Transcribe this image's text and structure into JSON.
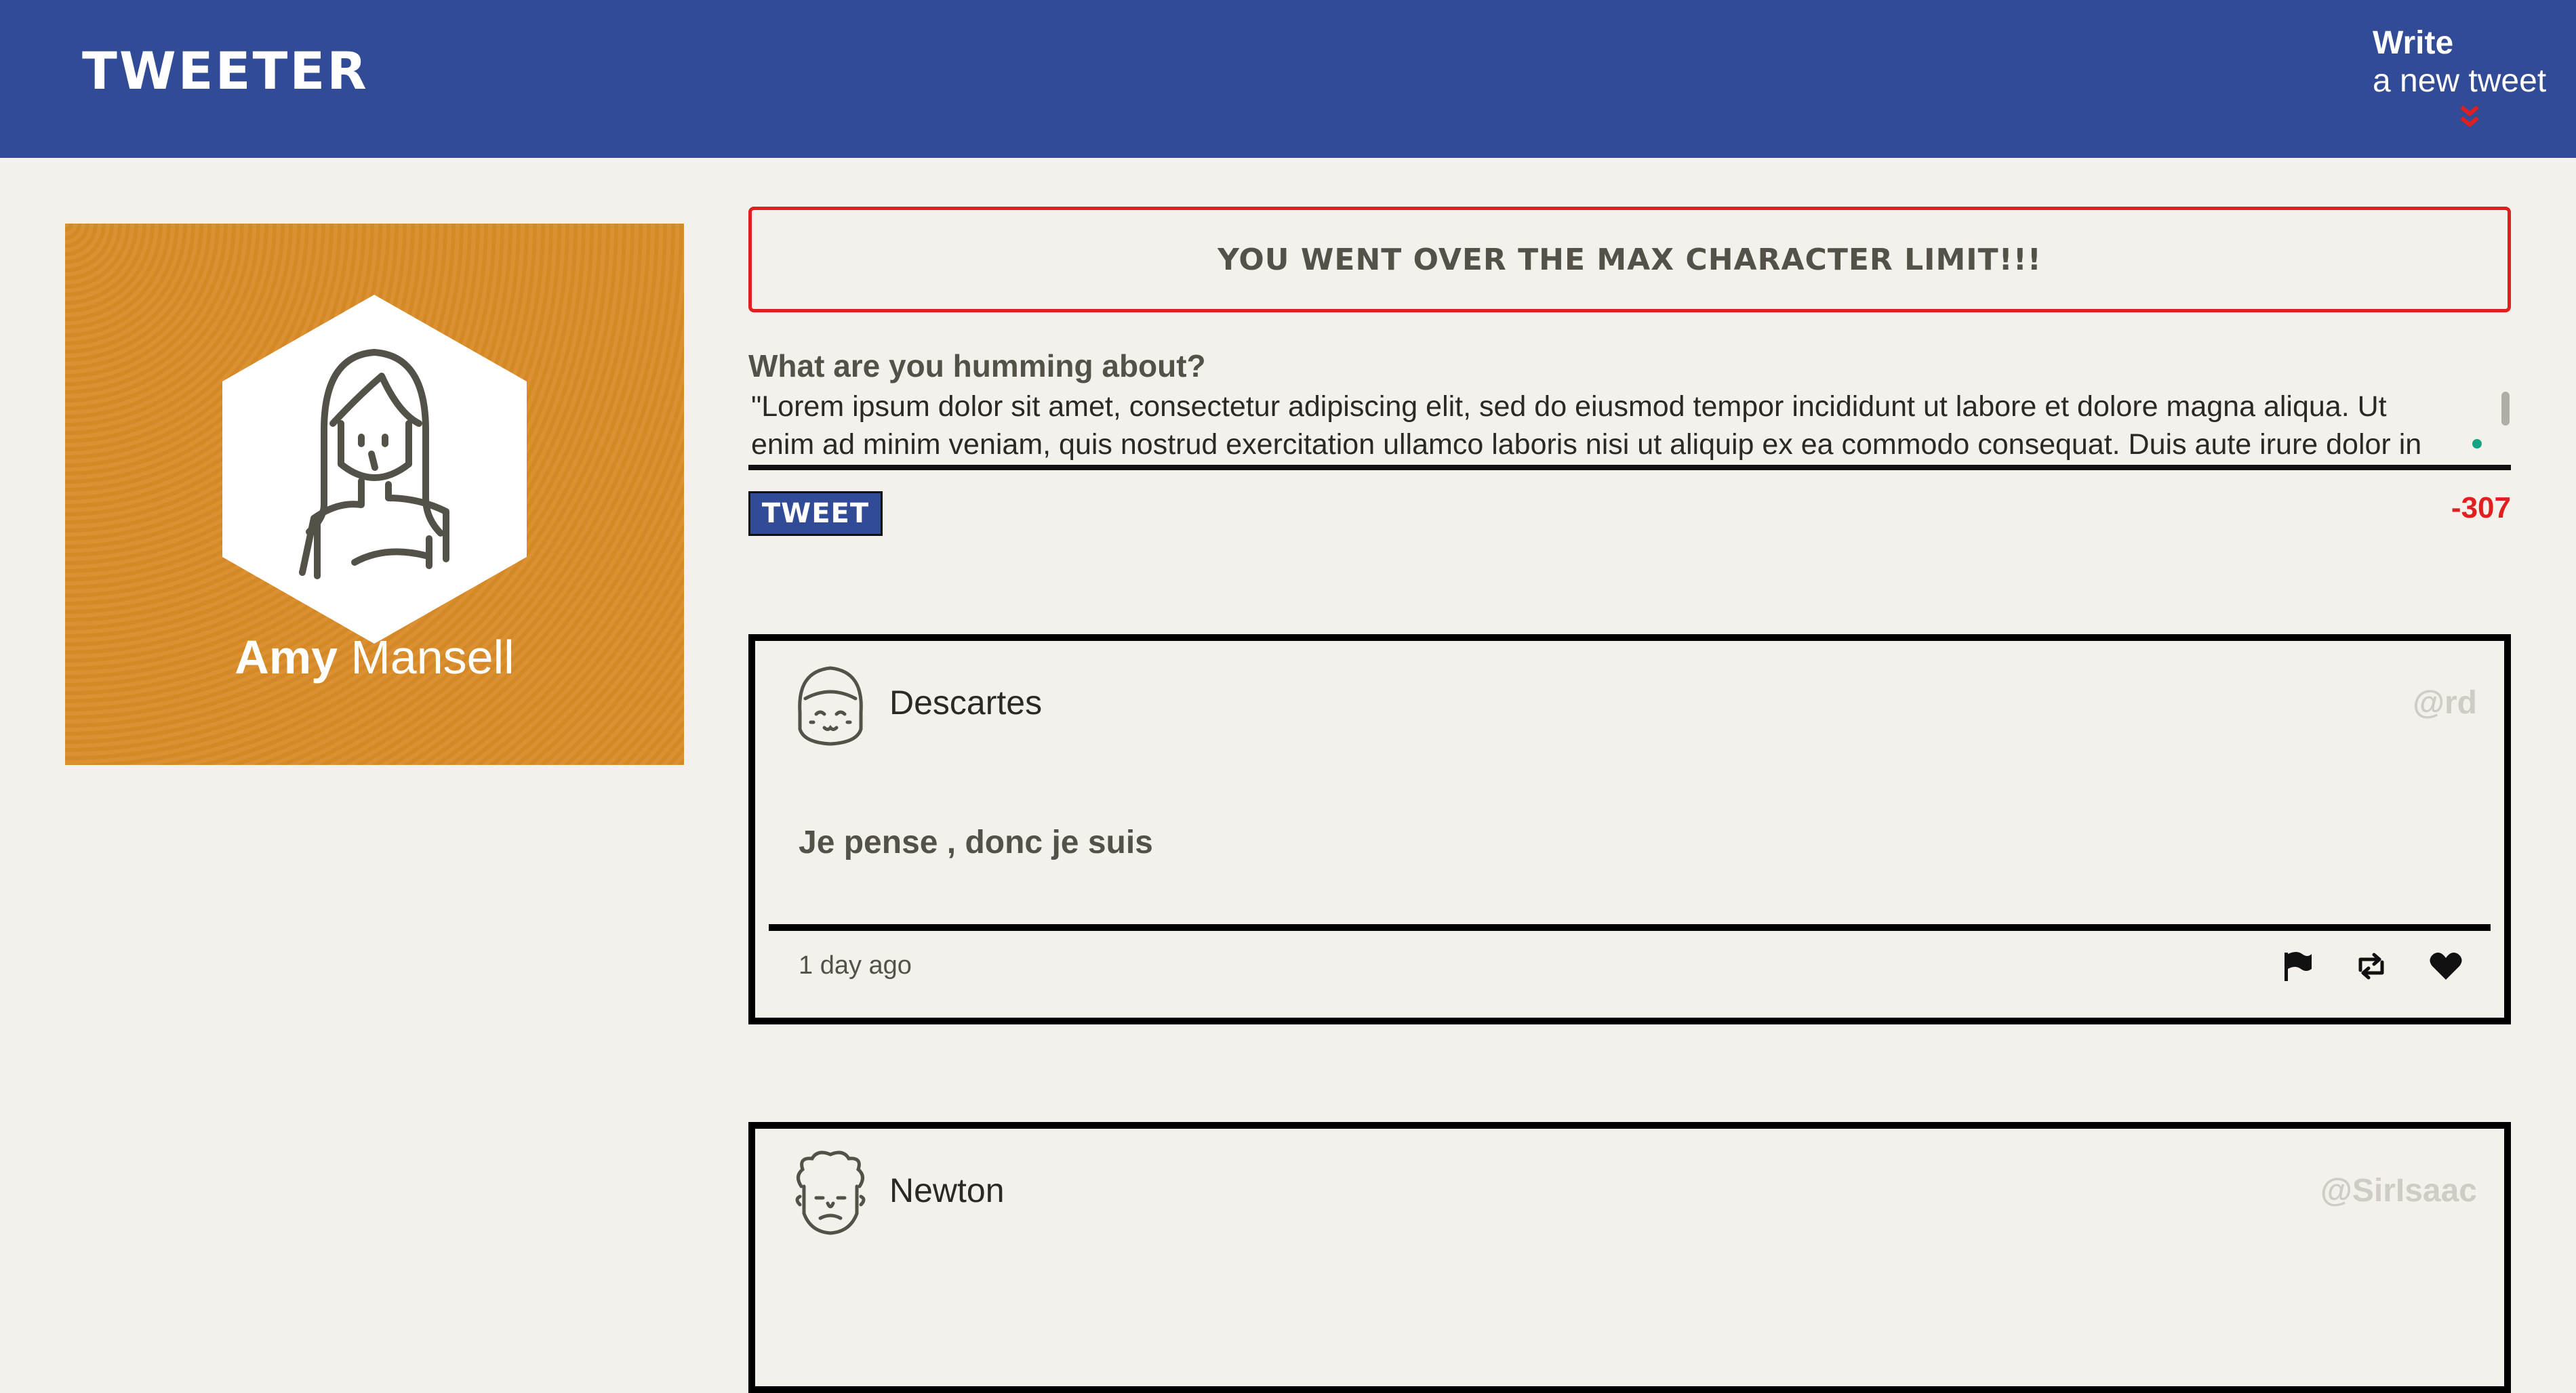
{
  "nav": {
    "brand": "Tweeter",
    "write_strong": "Write",
    "write_sub": "a new tweet"
  },
  "profile": {
    "first_name": "Amy",
    "last_name": "Mansell",
    "bg_color": "#d98b27"
  },
  "compose": {
    "error": "You went over the max character limit!!!",
    "label": "What are you humming about?",
    "text": "\"Lorem ipsum dolor sit amet, consectetur adipiscing elit, sed do eiusmod tempor incididunt ut labore et dolore magna aliqua. Ut enim ad minim veniam, quis nostrud exercitation ullamco laboris nisi ut aliquip ex ea commodo consequat. Duis aute irure dolor in",
    "button": "Tweet",
    "counter": "-307"
  },
  "tweets": [
    {
      "name": "Descartes",
      "handle": "@rd",
      "content": "Je pense , donc je suis",
      "time": "1 day ago"
    },
    {
      "name": "Newton",
      "handle": "@SirIsaac"
    }
  ],
  "icons": {
    "chevron": "chevron-double-down-icon",
    "flag": "flag-icon",
    "retweet": "retweet-icon",
    "like": "heart-icon"
  },
  "colors": {
    "nav": "#324b96",
    "error": "#e02020",
    "accent_red": "#e02020"
  }
}
